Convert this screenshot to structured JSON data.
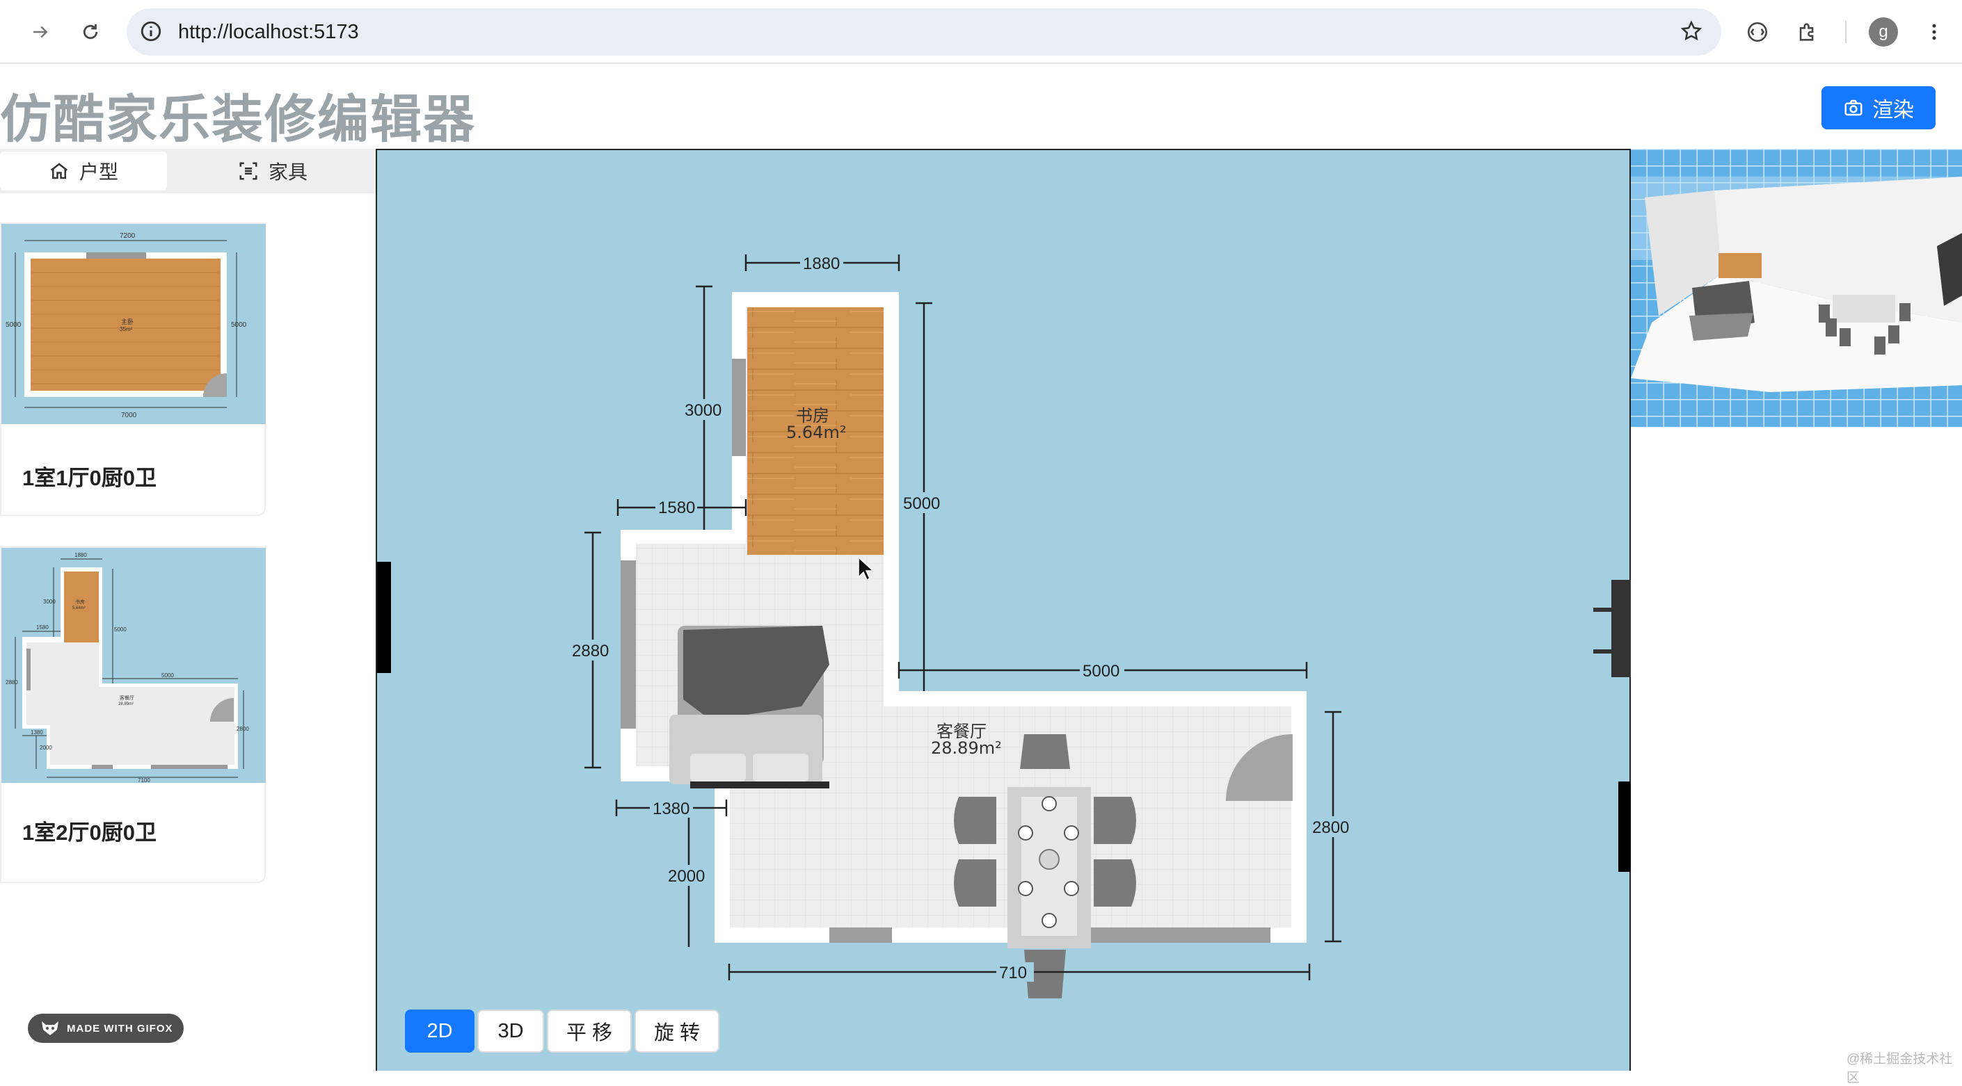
{
  "browser": {
    "url": "http://localhost:5173",
    "avatar_letter": "g"
  },
  "header": {
    "title": "仿酷家乐装修编辑器",
    "render_label": "渲染"
  },
  "left_panel": {
    "tabs": [
      {
        "label": "户型",
        "icon": "home-icon",
        "active": true
      },
      {
        "label": "家具",
        "icon": "furniture-scan-icon",
        "active": false
      }
    ],
    "plans": [
      {
        "name": "1室1厅0厨0卫",
        "thumb_dims": [
          "7200",
          "5000",
          "5000",
          "7000"
        ],
        "room_label": "主卧",
        "room_area": "35m²"
      },
      {
        "name": "1室2厅0厨0卫",
        "thumb_dims": [
          "1880",
          "3000",
          "5000",
          "1580",
          "2880",
          "5000",
          "1380",
          "2800",
          "2000",
          "7100"
        ],
        "room_label": "书房",
        "room_area": "5.64m²",
        "hall_label": "客餐厅",
        "hall_area": "28.89m²"
      }
    ],
    "badge": "MADE WITH GIFOX"
  },
  "canvas": {
    "dimensions": {
      "top": "1880",
      "study_left": "3000",
      "study_right": "5000",
      "step": "1580",
      "living_left": "2880",
      "hall_top": "5000",
      "bottom_step": "1380",
      "hall_right": "2800",
      "bottom_left": "2000",
      "bottom": "710"
    },
    "rooms": [
      {
        "name": "书房",
        "area": "5.64m²"
      },
      {
        "name": "客餐厅",
        "area": "28.89m²"
      }
    ],
    "view_modes": [
      "2D",
      "3D",
      "平 移",
      "旋 转"
    ],
    "active_mode": "2D"
  },
  "watermark": "@稀土掘金技术社区",
  "colors": {
    "accent": "#1677ff",
    "canvas_bg": "#a3cfe0",
    "floor_wood": "#d2904e",
    "floor_tile": "#ececec"
  }
}
